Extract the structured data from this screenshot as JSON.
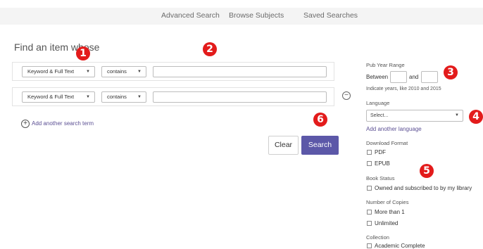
{
  "nav": {
    "tabs": [
      "Advanced Search",
      "Browse Subjects",
      "Saved Searches"
    ]
  },
  "main": {
    "title": "Find an item whose",
    "rows": [
      {
        "field": "Keyword & Full Text",
        "operator": "contains",
        "value": ""
      },
      {
        "field": "Keyword & Full Text",
        "operator": "contains",
        "value": ""
      }
    ],
    "add_term": "Add another search term",
    "clear_label": "Clear",
    "search_label": "Search"
  },
  "filters": {
    "pub_year": {
      "label": "Pub Year Range",
      "between": "Between",
      "and": "and",
      "hint": "Indicate years, like 2010 and 2015"
    },
    "language": {
      "label": "Language",
      "placeholder": "Select...",
      "add_label": "Add another language"
    },
    "download_format": {
      "label": "Download Format",
      "options": [
        "PDF",
        "EPUB"
      ]
    },
    "book_status": {
      "label": "Book Status",
      "options": [
        "Owned and subscribed to by my library"
      ]
    },
    "copies": {
      "label": "Number of Copies",
      "options": [
        "More than 1",
        "Unlimited"
      ]
    },
    "collection": {
      "label": "Collection",
      "options": [
        "Academic Complete"
      ]
    }
  },
  "annotations": [
    "1",
    "2",
    "3",
    "4",
    "5",
    "6"
  ],
  "icons": {
    "caret": "caret-down-icon",
    "remove": "minus-circle-icon",
    "add": "plus-circle-icon"
  },
  "colors": {
    "accent": "#5c58a8",
    "marker": "#e31b1b",
    "link": "#5b4f93"
  }
}
